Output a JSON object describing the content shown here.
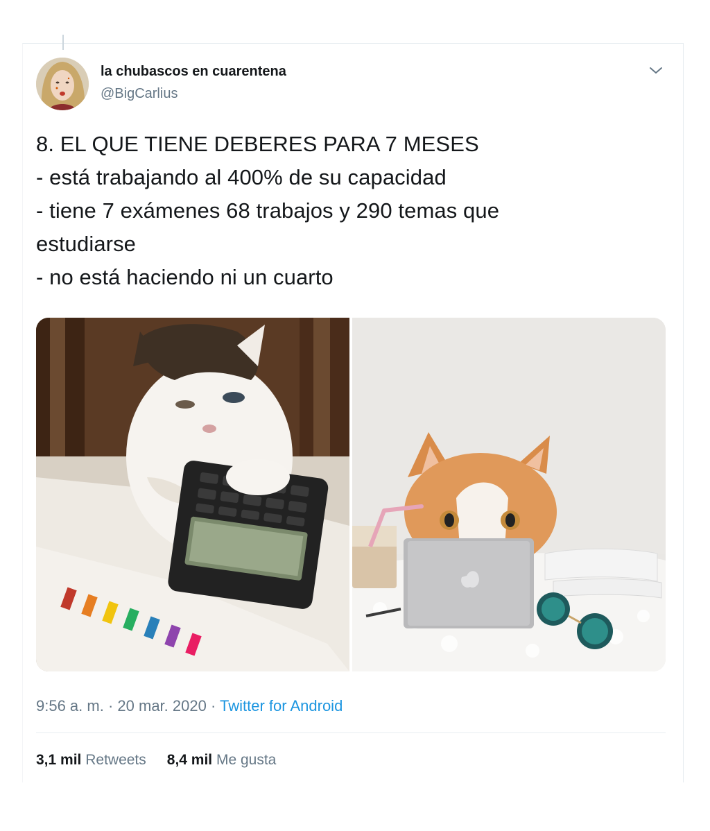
{
  "tweet": {
    "author": {
      "name": "la chubascos en cuarentena",
      "handle": "@BigCarlius",
      "avatar_icon": "user-avatar"
    },
    "menu_icon": "chevron-down-icon",
    "text_lines": [
      "8. EL QUE TIENE DEBERES PARA 7 MESES",
      "- está trabajando al 400% de su capacidad",
      "- tiene 7 exámenes 68 trabajos y 290 temas que",
      "estudiarse",
      "- no está haciendo ni un cuarto"
    ],
    "media": [
      {
        "kind": "photo",
        "icon": "cat-with-calculator-photo"
      },
      {
        "kind": "photo",
        "icon": "cat-with-laptop-photo"
      }
    ],
    "meta": {
      "time": "9:56 a. m.",
      "separator": " · ",
      "date": "20 mar. 2020",
      "source": "Twitter for Android"
    },
    "stats": {
      "retweets_count": "3,1 mil",
      "retweets_label": "Retweets",
      "likes_count": "8,4 mil",
      "likes_label": "Me gusta"
    },
    "colors": {
      "text": "#14171a",
      "secondary": "#657786",
      "link": "#1b95e0",
      "divider": "#e6ecf0"
    }
  }
}
